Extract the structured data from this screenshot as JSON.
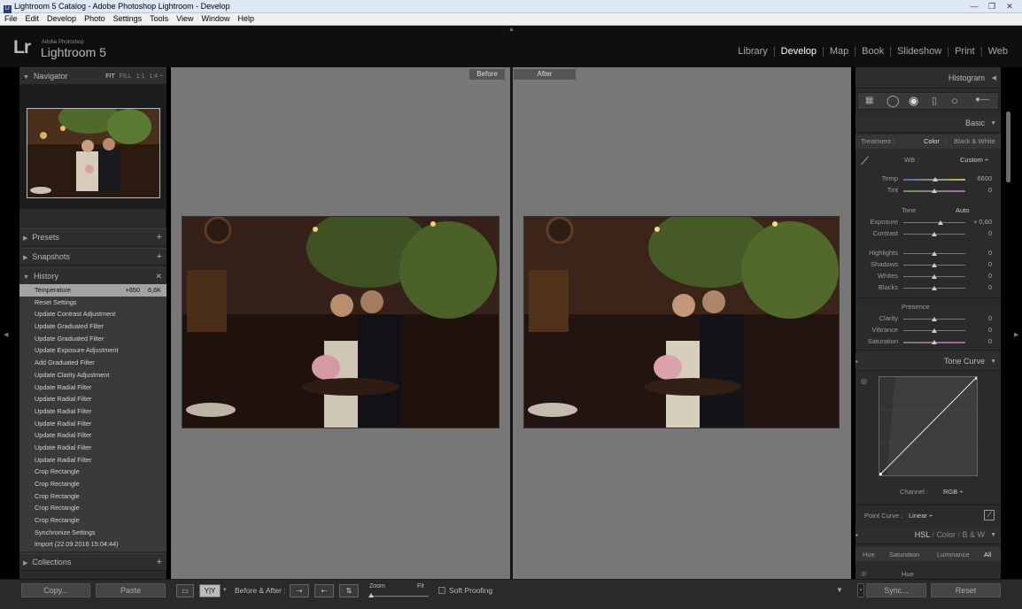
{
  "window": {
    "title": "Lightroom 5 Catalog - Adobe Photoshop Lightroom - Develop",
    "controls": [
      "—",
      "❐",
      "✕"
    ]
  },
  "menu": [
    "File",
    "Edit",
    "Develop",
    "Photo",
    "Settings",
    "Tools",
    "View",
    "Window",
    "Help"
  ],
  "identity": {
    "lr": "Lr",
    "brand_small": "Adobe Photoshop",
    "brand_big": "Lightroom 5"
  },
  "modules": {
    "library": "Library",
    "develop": "Develop",
    "map": "Map",
    "book": "Book",
    "slideshow": "Slideshow",
    "print": "Print",
    "web": "Web"
  },
  "left_panel": {
    "navigator": {
      "title": "Navigator",
      "options": [
        "FIT",
        "FILL",
        "1:1",
        "1:4 ÷"
      ]
    },
    "presets": "Presets",
    "snapshots": "Snapshots",
    "history_title": "History",
    "history": [
      {
        "label": "Temperature",
        "v1": "+650",
        "v2": "6,6K"
      },
      {
        "label": "Reset Settings",
        "v1": "",
        "v2": ""
      },
      {
        "label": "Update Contrast Adjustment",
        "v1": "",
        "v2": ""
      },
      {
        "label": "Update Graduated Filter",
        "v1": "",
        "v2": ""
      },
      {
        "label": "Update Graduated Filter",
        "v1": "",
        "v2": ""
      },
      {
        "label": "Update Exposure Adjustment",
        "v1": "",
        "v2": ""
      },
      {
        "label": "Add Graduated Filter",
        "v1": "",
        "v2": ""
      },
      {
        "label": "Update Clarity Adjustment",
        "v1": "",
        "v2": ""
      },
      {
        "label": "Update Radial Filter",
        "v1": "",
        "v2": ""
      },
      {
        "label": "Update Radial Filter",
        "v1": "",
        "v2": ""
      },
      {
        "label": "Update Radial Filter",
        "v1": "",
        "v2": ""
      },
      {
        "label": "Update Radial Filter",
        "v1": "",
        "v2": ""
      },
      {
        "label": "Update Radial Filter",
        "v1": "",
        "v2": ""
      },
      {
        "label": "Update Radial Filter",
        "v1": "",
        "v2": ""
      },
      {
        "label": "Update Radial Filter",
        "v1": "",
        "v2": ""
      },
      {
        "label": "Crop Rectangle",
        "v1": "",
        "v2": ""
      },
      {
        "label": "Crop Rectangle",
        "v1": "",
        "v2": ""
      },
      {
        "label": "Crop Rectangle",
        "v1": "",
        "v2": ""
      },
      {
        "label": "Crop Rectangle",
        "v1": "",
        "v2": ""
      },
      {
        "label": "Crop Rectangle",
        "v1": "",
        "v2": ""
      },
      {
        "label": "Synchronize Settings",
        "v1": "",
        "v2": ""
      },
      {
        "label": "Import (22.09.2016 15:04:44)",
        "v1": "",
        "v2": ""
      }
    ],
    "collections": "Collections",
    "copy": "Copy...",
    "paste": "Paste"
  },
  "center": {
    "before_label": "Before",
    "after_label": "After"
  },
  "toolbar": {
    "view_yy": "Y|Y",
    "before_after": "Before & After :",
    "zoom": "Zoom",
    "fit": "Fit",
    "soft_proofing": "Soft Proofing"
  },
  "right_panel": {
    "histogram": "Histogram",
    "basic": "Basic",
    "treatment": "Treatment :",
    "color": "Color",
    "bw": "Black & White",
    "wb": "WB :",
    "wb_value": "Custom ÷",
    "tone": "Tone",
    "auto": "Auto",
    "presence": "Presence",
    "sliders": {
      "temp": {
        "label": "Temp",
        "value": "6600",
        "pos": 0.52
      },
      "tint": {
        "label": "Tint",
        "value": "0",
        "pos": 0.5
      },
      "exposure": {
        "label": "Exposure",
        "value": "+ 0,60",
        "pos": 0.6
      },
      "contrast": {
        "label": "Contrast",
        "value": "0",
        "pos": 0.5
      },
      "highlights": {
        "label": "Highlights",
        "value": "0",
        "pos": 0.5
      },
      "shadows": {
        "label": "Shadows",
        "value": "0",
        "pos": 0.5
      },
      "whites": {
        "label": "Whites",
        "value": "0",
        "pos": 0.5
      },
      "blacks": {
        "label": "Blacks",
        "value": "0",
        "pos": 0.5
      },
      "clarity": {
        "label": "Clarity",
        "value": "0",
        "pos": 0.5
      },
      "vibrance": {
        "label": "Vibrance",
        "value": "0",
        "pos": 0.5
      },
      "saturation": {
        "label": "Saturation",
        "value": "0",
        "pos": 0.5
      }
    },
    "tone_curve": "Tone Curve",
    "channel": "Channel :",
    "channel_value": "RGB ÷",
    "point_curve": "Point Curve :",
    "point_curve_value": "Linear ÷",
    "hsl": "HSL",
    "hsl_color": "Color",
    "hsl_bw": "B & W",
    "hue_tab": "Hue",
    "saturation_tab": "Saturation",
    "luminance_tab": "Luminance",
    "all_tab": "All",
    "hue": "Hue",
    "sync": "Sync...",
    "reset": "Reset"
  }
}
